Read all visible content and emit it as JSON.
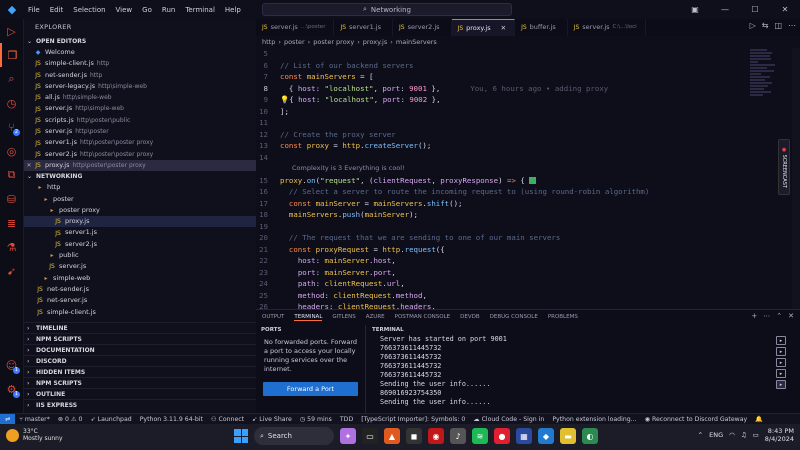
{
  "titlebar": {
    "menu": [
      "File",
      "Edit",
      "Selection",
      "View",
      "Go",
      "Run",
      "Terminal",
      "Help"
    ],
    "command_center": "Networking"
  },
  "activity": {
    "badge_source_control": "2",
    "badge_extensions": "1",
    "badge_accounts": "1"
  },
  "sidebar": {
    "title": "EXPLORER",
    "open_editors": {
      "label": "OPEN EDITORS",
      "items": [
        {
          "name": "Welcome",
          "path": ""
        },
        {
          "name": "simple-client.js",
          "path": "http"
        },
        {
          "name": "net-sender.js",
          "path": "http"
        },
        {
          "name": "server-legacy.js",
          "path": "http\\simple-web"
        },
        {
          "name": "all.js",
          "path": "http\\simple-web"
        },
        {
          "name": "server.js",
          "path": "http\\simple-web"
        },
        {
          "name": "scripts.js",
          "path": "http\\poster\\public"
        },
        {
          "name": "server.js",
          "path": "http\\poster"
        },
        {
          "name": "server1.js",
          "path": "http\\poster\\poster proxy"
        },
        {
          "name": "server2.js",
          "path": "http\\poster\\poster proxy"
        },
        {
          "name": "proxy.js",
          "path": "http\\poster\\poster proxy"
        }
      ]
    },
    "workspace": {
      "label": "NETWORKING",
      "items": [
        {
          "name": "http",
          "type": "folder"
        },
        {
          "name": "poster",
          "type": "folder"
        },
        {
          "name": "poster proxy",
          "type": "folder"
        },
        {
          "name": "proxy.js",
          "type": "js"
        },
        {
          "name": "server1.js",
          "type": "js"
        },
        {
          "name": "server2.js",
          "type": "js"
        },
        {
          "name": "public",
          "type": "folder"
        },
        {
          "name": "server.js",
          "type": "js"
        },
        {
          "name": "simple-web",
          "type": "folder"
        },
        {
          "name": "net-sender.js",
          "type": "js"
        },
        {
          "name": "net-server.js",
          "type": "js"
        },
        {
          "name": "simple-client.js",
          "type": "js"
        }
      ]
    },
    "bottom_sections": [
      "TIMELINE",
      "NPM SCRIPTS",
      "DOCUMENTATION",
      "DISCORD",
      "HIDDEN ITEMS",
      "NPM SCRIPTS",
      "OUTLINE",
      "IIS EXPRESS"
    ]
  },
  "editor": {
    "tabs": [
      {
        "name": "server.js",
        "dir": "...\\poster"
      },
      {
        "name": "server1.js",
        "dir": ""
      },
      {
        "name": "server2.js",
        "dir": ""
      },
      {
        "name": "proxy.js",
        "dir": ""
      },
      {
        "name": "buffer.js",
        "dir": ""
      },
      {
        "name": "server.js",
        "dir": "C:\\...\\loci"
      }
    ],
    "breadcrumb": [
      "http",
      "poster",
      "poster proxy",
      "proxy.js",
      "mainServers"
    ],
    "lens_complexity_is": "Complexity is 3 Everything is cool!",
    "blame": "You, 6 hours ago • adding proxy",
    "line_numbers": [
      "5",
      "6",
      "7",
      "8",
      "9",
      "10",
      "11",
      "12",
      "13",
      "14",
      "15",
      "16",
      "17",
      "18",
      "19",
      "20",
      "21",
      "22",
      "23",
      "24",
      "25",
      "26",
      "27"
    ]
  },
  "panel": {
    "tabs": [
      "OUTPUT",
      "TERMINAL",
      "GITLENS",
      "AZURE",
      "POSTMAN CONSOLE",
      "DEVDB",
      "DEBUG CONSOLE",
      "PROBLEMS"
    ],
    "ports_title": "PORTS",
    "ports_message": "No forwarded ports. Forward a port to access your locally running services over the internet.",
    "forward_button": "Forward a Port",
    "terminal_title": "TERMINAL",
    "terminal_lines": [
      "Server has started on port 9001",
      "766373611445732",
      "766373611445732",
      "766373611445732",
      "766373611445732",
      "Sending the user info......",
      "869016923754350",
      "Sending the user info......"
    ]
  },
  "status": {
    "branch": "master*",
    "errors": "0",
    "warnings": "0",
    "launchpad": "Launchpad",
    "python": "Python 3.11.9 64-bit",
    "connect": "Connect",
    "live_share": "Live Share",
    "time": "59 mins",
    "tdd": "TDD",
    "ts": "[TypeScript Importer]: Symbols: 0",
    "cloud_code": "Cloud Code - Sign in",
    "python_ext": "Python extension loading...",
    "discord": "Reconnect to Discord Gateway"
  },
  "taskbar": {
    "temp": "33°C",
    "weather": "Mostly sunny",
    "search": "Search",
    "lang": "ENG",
    "time": "8:43 PM",
    "date": "8/4/2024"
  },
  "colors": {
    "accent": "#ff6a3a",
    "button": "#1f6fd0"
  }
}
